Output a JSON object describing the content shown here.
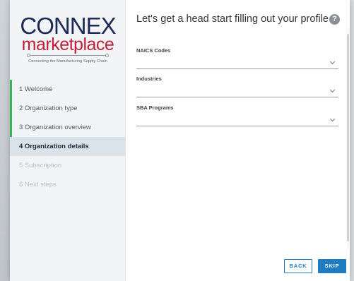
{
  "logo": {
    "brand": "CONNEX",
    "sub": "marketplace",
    "tagline": "Connecting the Manufacturing Supply Chain"
  },
  "steps": [
    {
      "label": "1  Welcome",
      "state": "done"
    },
    {
      "label": "2  Organization type",
      "state": "done"
    },
    {
      "label": "3  Organization overview",
      "state": "done"
    },
    {
      "label": "4  Organization details",
      "state": "active"
    },
    {
      "label": "5  Subscription",
      "state": "future"
    },
    {
      "label": "6  Next steps",
      "state": "future"
    }
  ],
  "main": {
    "title": "Let's get a head start filling out your profile",
    "help_icon": "?",
    "fields": [
      {
        "label": "NAICS Codes",
        "value": ""
      },
      {
        "label": "Industries",
        "value": ""
      },
      {
        "label": "SBA Programs",
        "value": ""
      }
    ]
  },
  "buttons": {
    "back": "BACK",
    "skip": "SKIP"
  },
  "colors": {
    "brand_navy": "#1b2a57",
    "brand_red": "#c21f3a",
    "step_done": "#3cb45a",
    "primary": "#1f7bc2"
  }
}
